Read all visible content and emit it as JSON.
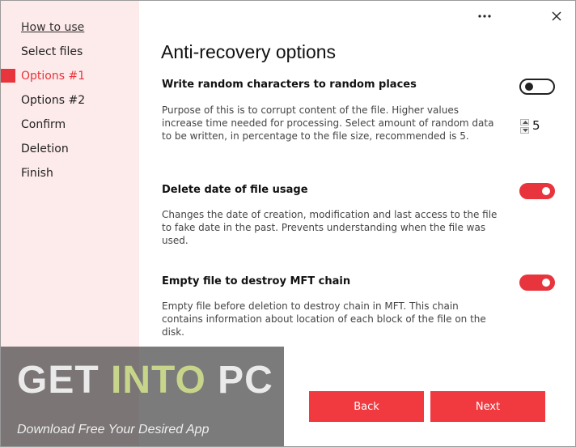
{
  "sidebar": {
    "items": [
      {
        "label": "How to use"
      },
      {
        "label": "Select files"
      },
      {
        "label": "Options #1"
      },
      {
        "label": "Options #2"
      },
      {
        "label": "Confirm"
      },
      {
        "label": "Deletion"
      },
      {
        "label": "Finish"
      }
    ],
    "active_index": 2
  },
  "titlebar": {
    "more_icon": "more-dots-icon",
    "close_icon": "close-icon"
  },
  "main": {
    "title": "Anti-recovery options",
    "options": [
      {
        "title": "Write random characters to random places",
        "description": "Purpose of this is to corrupt content of the file. Higher values increase time needed for processing. Select amount of random data to be written, in percentage to the file size, recommended is 5.",
        "enabled": false,
        "stepper_value": "5"
      },
      {
        "title": "Delete date of file usage",
        "description": "Changes the date of creation, modification and last access to the file to fake date in the past. Prevents understanding when the file was used.",
        "enabled": true
      },
      {
        "title": "Empty file to destroy MFT chain",
        "description": "Empty file before deletion to destroy chain in MFT. This chain contains information about location of each block of the file on the disk.",
        "enabled": true
      }
    ]
  },
  "footer": {
    "back_label": "Back",
    "next_label": "Next"
  },
  "watermark": {
    "logo_get": "GET ",
    "logo_into": "INTO",
    "logo_pc": " PC",
    "tagline": "Download Free Your Desired App"
  },
  "colors": {
    "accent": "#e8343c",
    "sidebar_bg": "#fdeaea"
  }
}
